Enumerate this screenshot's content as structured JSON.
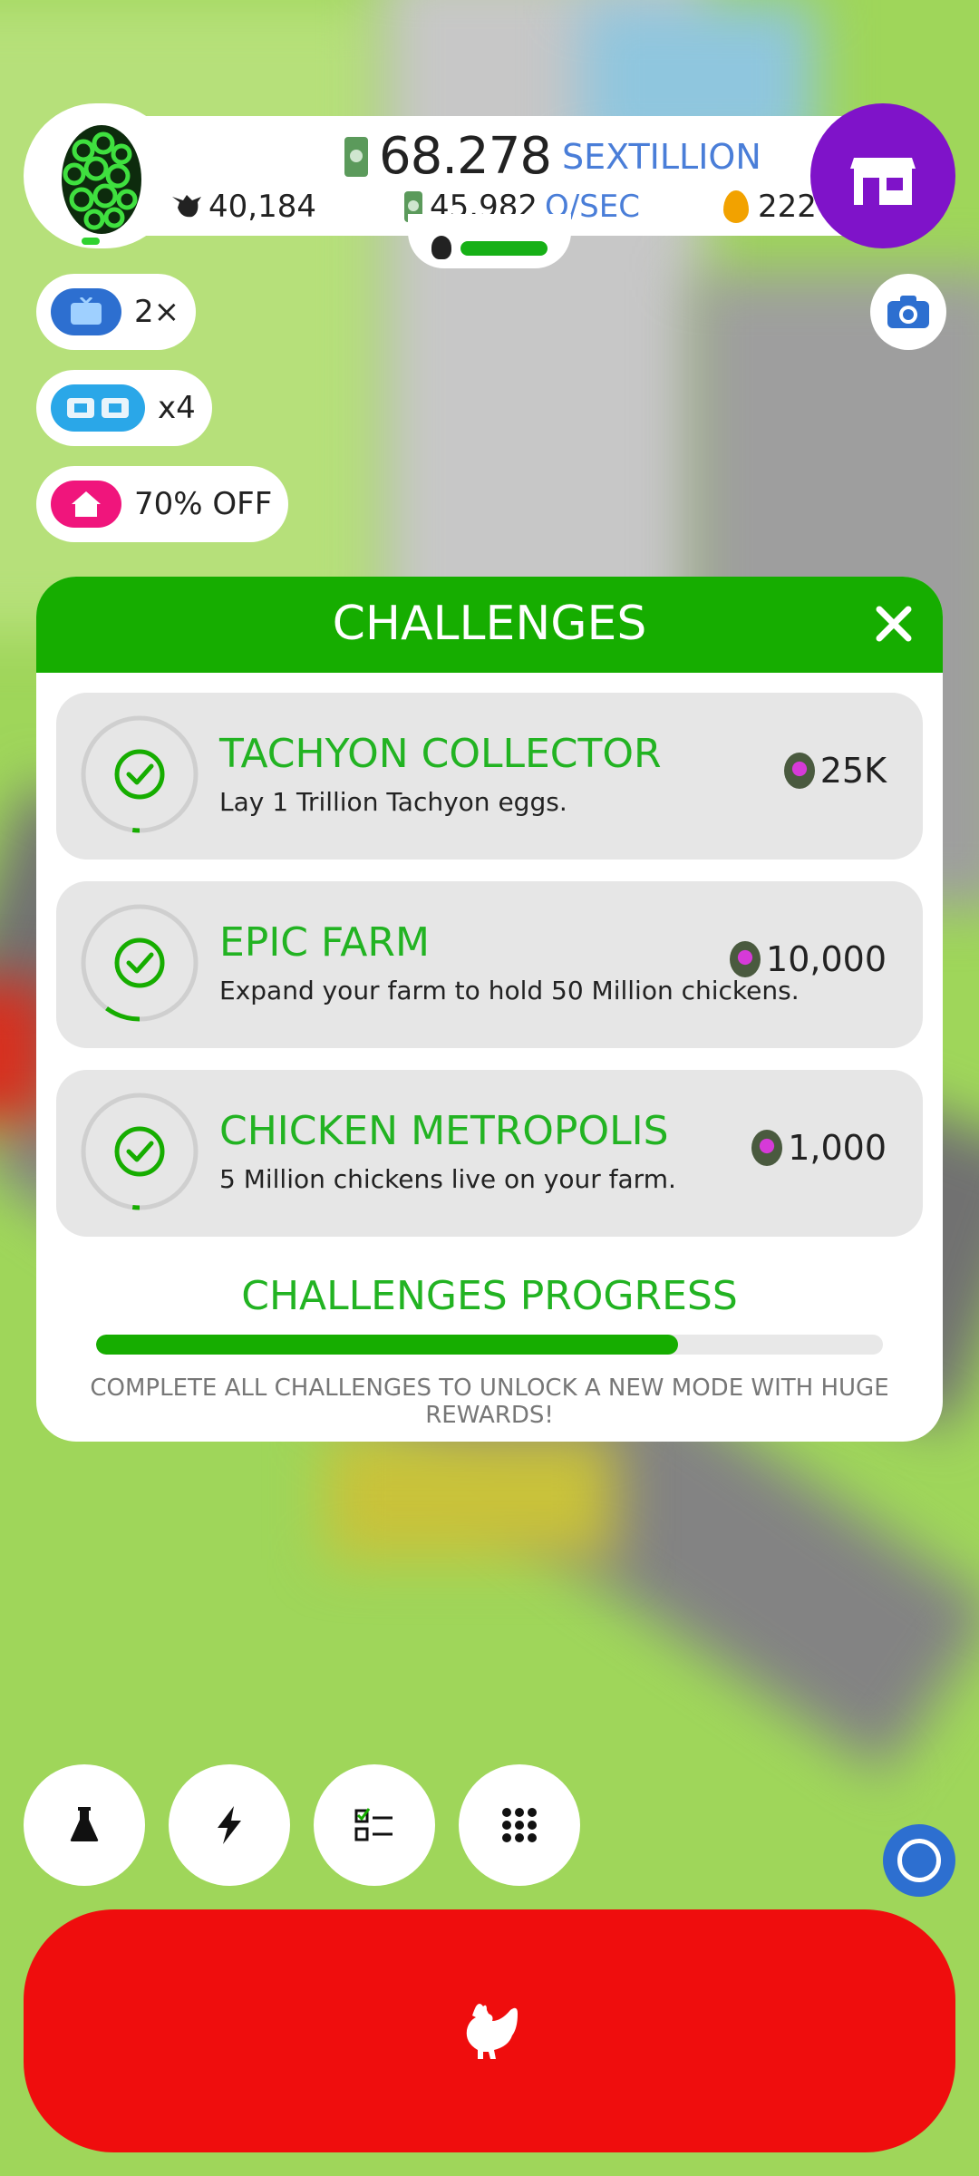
{
  "header": {
    "money_value": "68.278",
    "money_unit": "SEXTILLION",
    "chicken_count": "40,184",
    "rate_value": "45.982",
    "rate_unit": "Q/SEC",
    "golden_eggs": "222"
  },
  "boosts": [
    {
      "icon": "tv-icon",
      "label": "2×"
    },
    {
      "icon": "boost-icon",
      "label": "x4"
    },
    {
      "icon": "house-icon",
      "label": "70% OFF"
    }
  ],
  "challenges": {
    "title": "CHALLENGES",
    "items": [
      {
        "title": "TACHYON COLLECTOR",
        "description": "Lay 1 Trillion Tachyon eggs.",
        "reward": "25K",
        "progress": 0.02
      },
      {
        "title": "EPIC FARM",
        "description": "Expand your farm to hold 50 Million chickens.",
        "reward": "10,000",
        "progress": 0.1
      },
      {
        "title": "CHICKEN METROPOLIS",
        "description": "5 Million chickens live on your farm.",
        "reward": "1,000",
        "progress": 0.02
      }
    ],
    "progress_title": "CHALLENGES PROGRESS",
    "progress_fraction": 0.74,
    "progress_note": "COMPLETE ALL CHALLENGES TO UNLOCK A NEW MODE WITH HUGE REWARDS!"
  },
  "bottom_nav": [
    "flask-icon",
    "lightning-icon",
    "checklist-icon",
    "grid-icon"
  ],
  "colors": {
    "accent_green": "#16ad00",
    "shop_purple": "#7f13c9",
    "hatch_red": "#ef0d0d",
    "text_blue": "#4a7ed8"
  }
}
